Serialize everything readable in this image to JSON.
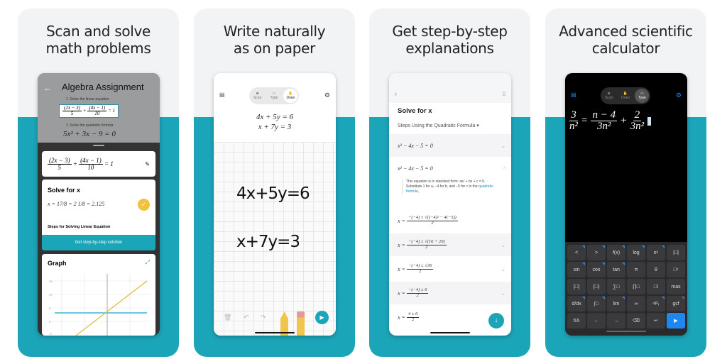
{
  "colors": {
    "teal": "#1aa5b8",
    "accent_blue": "#1e88f0",
    "check_yellow": "#f3c23c"
  },
  "panels": [
    {
      "title_line1": "Scan and solve",
      "title_line2": "math problems",
      "scan": {
        "doc_title": "Algebra Assignment",
        "q1": "1. Solve the linear equation",
        "q2": "2. Solve the quadratic formula",
        "q2_eq": "5x² + 3x − 9 = 0"
      },
      "equation": {
        "a_num": "(2x − 3)",
        "a_den": "5",
        "b_num": "(4x − 1)",
        "b_den": "10",
        "rhs": "= 1"
      },
      "solve": {
        "title": "Solve for x",
        "result": "x = 17/8 = 2 1/8 = 2.125",
        "steps_label": "Steps for Solving Linear Equation",
        "button": "Get step-by-step solution"
      },
      "graph": {
        "title": "Graph",
        "y_ticks": [
          "15",
          "10",
          "5",
          "0",
          "-5"
        ]
      }
    },
    {
      "title_line1": "Write naturally",
      "title_line2": "as on paper",
      "modes": [
        "Scan",
        "Type",
        "Draw"
      ],
      "active_mode": "Draw",
      "recognized": [
        "4x + 5y = 6",
        "x + 7y = 3"
      ],
      "handwritten": [
        "4x+5y=6",
        "x+7y=3"
      ]
    },
    {
      "title_line1": "Get step-by-step",
      "title_line2": "explanations",
      "title": "Solve for x",
      "method": "Steps Using the Quadratic Formula",
      "steps": [
        "x² − 4x − 5 = 0",
        "x² − 4x − 5 = 0"
      ],
      "explanation": "This equation is in standard form: ax² + bx + c = 0. Substitute 1 for a, −4 for b, and −5 for c in the",
      "explanation_link": "quadratic formula,",
      "derivation": [
        {
          "num": "−(−4) ± √((−4)² − 4(−5))",
          "den": "2"
        },
        {
          "num": "−(−4) ± √(16 + 20)",
          "den": "2"
        },
        {
          "num": "−(−4) ± √36",
          "den": "2"
        },
        {
          "num": "−(−4) ± 6",
          "den": "2"
        },
        {
          "num": "4 ± 6",
          "den": "2"
        }
      ]
    },
    {
      "title_line1": "Advanced scientific",
      "title_line2": "calculator",
      "modes": [
        "Scan",
        "Draw",
        "Type"
      ],
      "active_mode": "Type",
      "equation": {
        "l_num": "3",
        "l_den": "n²",
        "r1_num": "n − 4",
        "r1_den": "3n²",
        "r2_num": "2",
        "r2_den": "3n²"
      },
      "keys": [
        [
          "<",
          ">",
          "f(x)",
          "log",
          "eˣ",
          "|□|"
        ],
        [
          "sin",
          "cos",
          "tan",
          "π",
          "θ",
          "□ⁿ"
        ],
        [
          "[□]",
          "{□}",
          "∑□",
          "∏□",
          "□!",
          "max"
        ],
        [
          "d/dx",
          "∫□",
          "lim",
          "∞",
          "ⁿPᵣ",
          "gcf"
        ],
        [
          "f/A",
          "←",
          "→",
          "⌫",
          "↵",
          "▶"
        ]
      ]
    }
  ]
}
